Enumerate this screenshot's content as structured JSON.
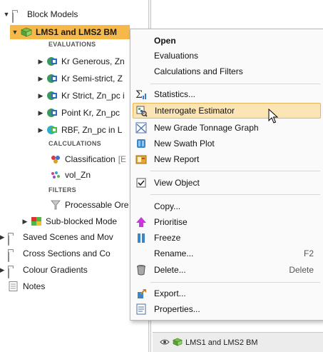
{
  "tree": {
    "block_models": "Block Models",
    "selected_model": "LMS1 and LMS2 BM",
    "evaluations_header": "EVALUATIONS",
    "evaluations": [
      "Kr Generous, Zn",
      "Kr Semi-strict, Z",
      "Kr Strict, Zn_pc i",
      "Point Kr, Zn_pc",
      "RBF, Zn_pc in L"
    ],
    "calculations_header": "CALCULATIONS",
    "calculations": [
      {
        "label": "Classification",
        "suffix": "[E"
      },
      {
        "label": "vol_Zn",
        "suffix": ""
      }
    ],
    "filters_header": "FILTERS",
    "filters": [
      "Processable Ore"
    ],
    "sub_blocked": "Sub-blocked Mode",
    "saved_scenes": "Saved Scenes and Mov",
    "cross_sections": "Cross Sections and Co",
    "colour_gradients": "Colour Gradients",
    "notes": "Notes"
  },
  "menu": {
    "open": "Open",
    "evaluations": "Evaluations",
    "calc_filters": "Calculations and Filters",
    "statistics": "Statistics...",
    "interrogate": "Interrogate Estimator",
    "grade_tonnage": "New Grade Tonnage Graph",
    "swath": "New Swath Plot",
    "report": "New Report",
    "view_object": "View Object",
    "copy": "Copy...",
    "prioritise": "Prioritise",
    "freeze": "Freeze",
    "rename": "Rename...",
    "rename_shortcut": "F2",
    "delete": "Delete...",
    "delete_shortcut": "Delete",
    "export": "Export...",
    "properties": "Properties..."
  },
  "bottom": {
    "label": "LMS1 and LMS2 BM"
  },
  "colors": {
    "selection": "#f7b84a",
    "menu_highlight": "#fbe5b4",
    "menu_highlight_border": "#e9b454"
  }
}
